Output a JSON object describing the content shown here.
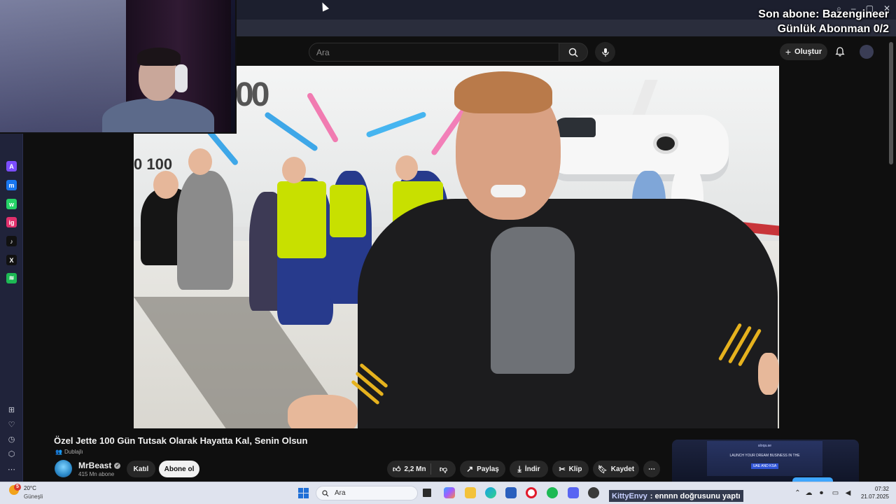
{
  "overlay": {
    "last_sub": "Son abone: Bazengineer",
    "daily_subs": "Günlük Abonman 0/2"
  },
  "sidebar": {
    "apps": [
      {
        "name": "aria",
        "color": "#7c4dff",
        "glyph": "A"
      },
      {
        "name": "messenger",
        "color": "#1877f2",
        "glyph": "m"
      },
      {
        "name": "whatsapp",
        "color": "#25d366",
        "glyph": "w"
      },
      {
        "name": "instagram",
        "color": "#e1306c",
        "glyph": "ig"
      },
      {
        "name": "tiktok",
        "color": "#111111",
        "glyph": "♪"
      },
      {
        "name": "x",
        "color": "#111111",
        "glyph": "X"
      },
      {
        "name": "spotify",
        "color": "#1db954",
        "glyph": "≋"
      }
    ]
  },
  "youtube": {
    "search_placeholder": "Ara",
    "create_label": "Oluştur",
    "video_title": "Özel Jette 100 Gün Tutsak Olarak Hayatta Kal, Senin Olsun",
    "dub_label": "Dublajlı",
    "channel_name": "MrBeast",
    "channel_subs": "415 Mn abone",
    "join_label": "Katıl",
    "subscribe_label": "Abone ol",
    "like_count": "2,2 Mn",
    "share_label": "Paylaş",
    "download_label": "İndir",
    "clip_label": "Klip",
    "save_label": "Kaydet",
    "more_label": "⋯",
    "video_sign": "00",
    "video_sign2": "0 100"
  },
  "ad": {
    "logo": "aloqa.ae",
    "line1": "LAUNCH YOUR DREAM BUSINESS IN THE",
    "line2": "UAE AND KSA"
  },
  "taskbar": {
    "weather_temp": "20°C",
    "weather_desc": "Güneşli",
    "weather_badge": "5",
    "search_label": "Ara",
    "chat_nick": "KittyEnvy",
    "chat_message": ": ennnn doğrusunu yaptı",
    "time": "07:32",
    "date": "21.07.2025"
  },
  "colors": {
    "accent": "#3ea6ff",
    "background": "#0f0f0f",
    "taskbar": "#dfe3ee"
  }
}
